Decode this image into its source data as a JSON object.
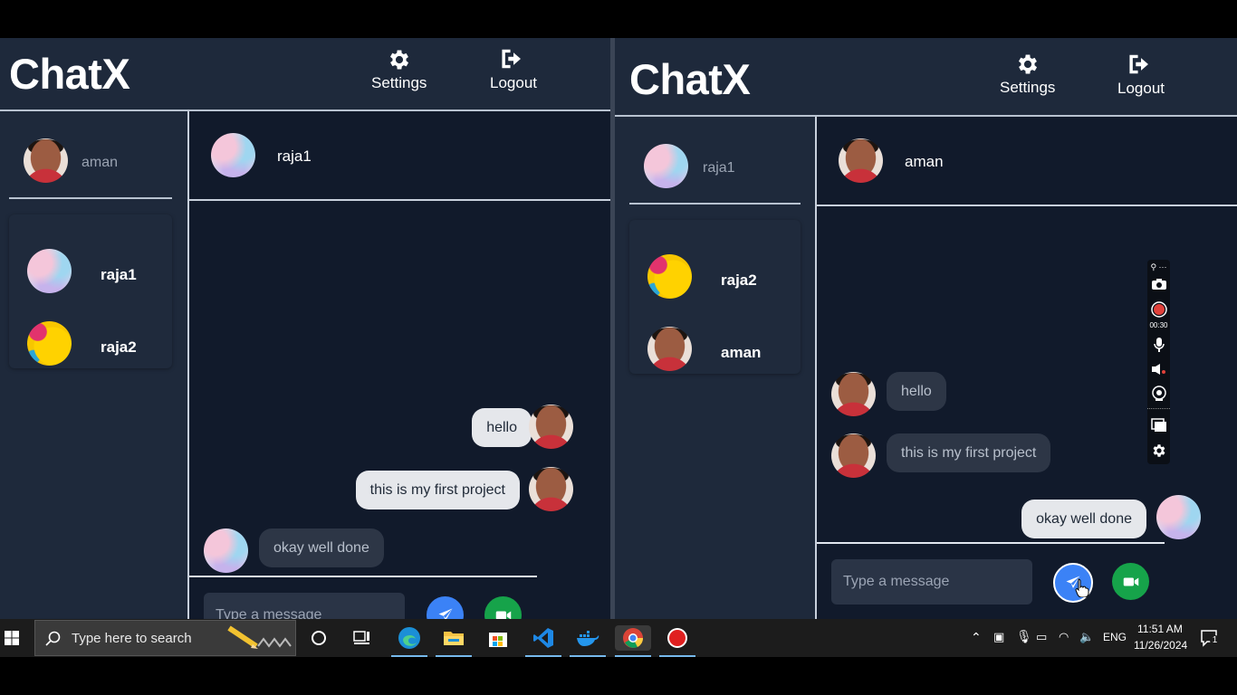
{
  "left_window": {
    "brand": "ChatX",
    "settings_label": "Settings",
    "logout_label": "Logout",
    "current_user": "aman",
    "contacts": [
      {
        "name": "raja1",
        "avatar": "pastel-avatar"
      },
      {
        "name": "raja2",
        "avatar": "yellow-avatar"
      }
    ],
    "active_chat": "raja1",
    "messages": [
      {
        "text": "hello",
        "direction": "sent"
      },
      {
        "text": "this is my first project",
        "direction": "sent"
      },
      {
        "text": "okay well done",
        "direction": "received"
      }
    ],
    "input_placeholder": "Type a message"
  },
  "right_window": {
    "brand": "ChatX",
    "settings_label": "Settings",
    "logout_label": "Logout",
    "current_user": "raja1",
    "contacts": [
      {
        "name": "raja2",
        "avatar": "yellow-avatar"
      },
      {
        "name": "aman",
        "avatar": "face-avatar"
      }
    ],
    "active_chat": "aman",
    "messages": [
      {
        "text": "hello",
        "direction": "received"
      },
      {
        "text": "this is my first project",
        "direction": "received"
      },
      {
        "text": "okay well done",
        "direction": "sent"
      }
    ],
    "input_placeholder": "Type a message"
  },
  "capture_toolbar": {
    "timer": "00:30",
    "icons": [
      "link-icon",
      "camera-icon",
      "record-icon",
      "microphone-icon",
      "speaker-icon",
      "webcam-icon",
      "window-icon",
      "gear-icon"
    ]
  },
  "taskbar": {
    "search_placeholder": "Type here to search",
    "apps": [
      "cortana-icon",
      "task-view-icon",
      "edge-icon",
      "file-explorer-icon",
      "store-icon",
      "vscode-icon",
      "docker-icon",
      "chrome-icon",
      "recorder-icon"
    ],
    "language": "ENG",
    "time": "11:51 AM",
    "date": "11/26/2024",
    "notification_count": "1"
  },
  "colors": {
    "header_bg": "#1e293b",
    "chat_bg": "#111a2b",
    "send_button": "#3b82f6",
    "video_button": "#16a34a",
    "bubble_sent": "#e5e7eb",
    "bubble_received": "#2d3646"
  }
}
